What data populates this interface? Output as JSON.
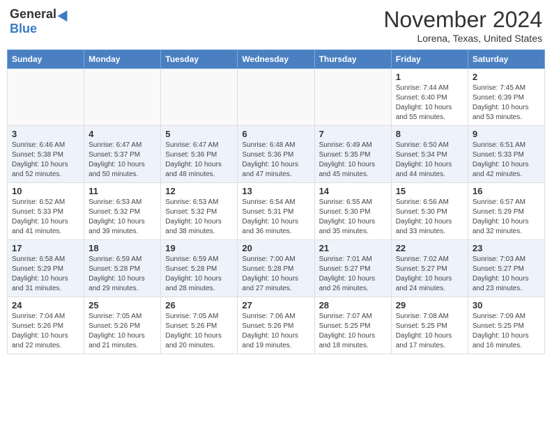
{
  "logo": {
    "general": "General",
    "blue": "Blue"
  },
  "header": {
    "month": "November 2024",
    "location": "Lorena, Texas, United States"
  },
  "weekdays": [
    "Sunday",
    "Monday",
    "Tuesday",
    "Wednesday",
    "Thursday",
    "Friday",
    "Saturday"
  ],
  "weeks": [
    [
      {
        "day": "",
        "empty": true
      },
      {
        "day": "",
        "empty": true
      },
      {
        "day": "",
        "empty": true
      },
      {
        "day": "",
        "empty": true
      },
      {
        "day": "",
        "empty": true
      },
      {
        "day": "1",
        "sunrise": "7:44 AM",
        "sunset": "6:40 PM",
        "daylight": "10 hours and 55 minutes."
      },
      {
        "day": "2",
        "sunrise": "7:45 AM",
        "sunset": "6:39 PM",
        "daylight": "10 hours and 53 minutes."
      }
    ],
    [
      {
        "day": "3",
        "sunrise": "6:46 AM",
        "sunset": "5:38 PM",
        "daylight": "10 hours and 52 minutes."
      },
      {
        "day": "4",
        "sunrise": "6:47 AM",
        "sunset": "5:37 PM",
        "daylight": "10 hours and 50 minutes."
      },
      {
        "day": "5",
        "sunrise": "6:47 AM",
        "sunset": "5:36 PM",
        "daylight": "10 hours and 48 minutes."
      },
      {
        "day": "6",
        "sunrise": "6:48 AM",
        "sunset": "5:36 PM",
        "daylight": "10 hours and 47 minutes."
      },
      {
        "day": "7",
        "sunrise": "6:49 AM",
        "sunset": "5:35 PM",
        "daylight": "10 hours and 45 minutes."
      },
      {
        "day": "8",
        "sunrise": "6:50 AM",
        "sunset": "5:34 PM",
        "daylight": "10 hours and 44 minutes."
      },
      {
        "day": "9",
        "sunrise": "6:51 AM",
        "sunset": "5:33 PM",
        "daylight": "10 hours and 42 minutes."
      }
    ],
    [
      {
        "day": "10",
        "sunrise": "6:52 AM",
        "sunset": "5:33 PM",
        "daylight": "10 hours and 41 minutes."
      },
      {
        "day": "11",
        "sunrise": "6:53 AM",
        "sunset": "5:32 PM",
        "daylight": "10 hours and 39 minutes."
      },
      {
        "day": "12",
        "sunrise": "6:53 AM",
        "sunset": "5:32 PM",
        "daylight": "10 hours and 38 minutes."
      },
      {
        "day": "13",
        "sunrise": "6:54 AM",
        "sunset": "5:31 PM",
        "daylight": "10 hours and 36 minutes."
      },
      {
        "day": "14",
        "sunrise": "6:55 AM",
        "sunset": "5:30 PM",
        "daylight": "10 hours and 35 minutes."
      },
      {
        "day": "15",
        "sunrise": "6:56 AM",
        "sunset": "5:30 PM",
        "daylight": "10 hours and 33 minutes."
      },
      {
        "day": "16",
        "sunrise": "6:57 AM",
        "sunset": "5:29 PM",
        "daylight": "10 hours and 32 minutes."
      }
    ],
    [
      {
        "day": "17",
        "sunrise": "6:58 AM",
        "sunset": "5:29 PM",
        "daylight": "10 hours and 31 minutes."
      },
      {
        "day": "18",
        "sunrise": "6:59 AM",
        "sunset": "5:28 PM",
        "daylight": "10 hours and 29 minutes."
      },
      {
        "day": "19",
        "sunrise": "6:59 AM",
        "sunset": "5:28 PM",
        "daylight": "10 hours and 28 minutes."
      },
      {
        "day": "20",
        "sunrise": "7:00 AM",
        "sunset": "5:28 PM",
        "daylight": "10 hours and 27 minutes."
      },
      {
        "day": "21",
        "sunrise": "7:01 AM",
        "sunset": "5:27 PM",
        "daylight": "10 hours and 26 minutes."
      },
      {
        "day": "22",
        "sunrise": "7:02 AM",
        "sunset": "5:27 PM",
        "daylight": "10 hours and 24 minutes."
      },
      {
        "day": "23",
        "sunrise": "7:03 AM",
        "sunset": "5:27 PM",
        "daylight": "10 hours and 23 minutes."
      }
    ],
    [
      {
        "day": "24",
        "sunrise": "7:04 AM",
        "sunset": "5:26 PM",
        "daylight": "10 hours and 22 minutes."
      },
      {
        "day": "25",
        "sunrise": "7:05 AM",
        "sunset": "5:26 PM",
        "daylight": "10 hours and 21 minutes."
      },
      {
        "day": "26",
        "sunrise": "7:05 AM",
        "sunset": "5:26 PM",
        "daylight": "10 hours and 20 minutes."
      },
      {
        "day": "27",
        "sunrise": "7:06 AM",
        "sunset": "5:26 PM",
        "daylight": "10 hours and 19 minutes."
      },
      {
        "day": "28",
        "sunrise": "7:07 AM",
        "sunset": "5:25 PM",
        "daylight": "10 hours and 18 minutes."
      },
      {
        "day": "29",
        "sunrise": "7:08 AM",
        "sunset": "5:25 PM",
        "daylight": "10 hours and 17 minutes."
      },
      {
        "day": "30",
        "sunrise": "7:09 AM",
        "sunset": "5:25 PM",
        "daylight": "10 hours and 16 minutes."
      }
    ]
  ]
}
